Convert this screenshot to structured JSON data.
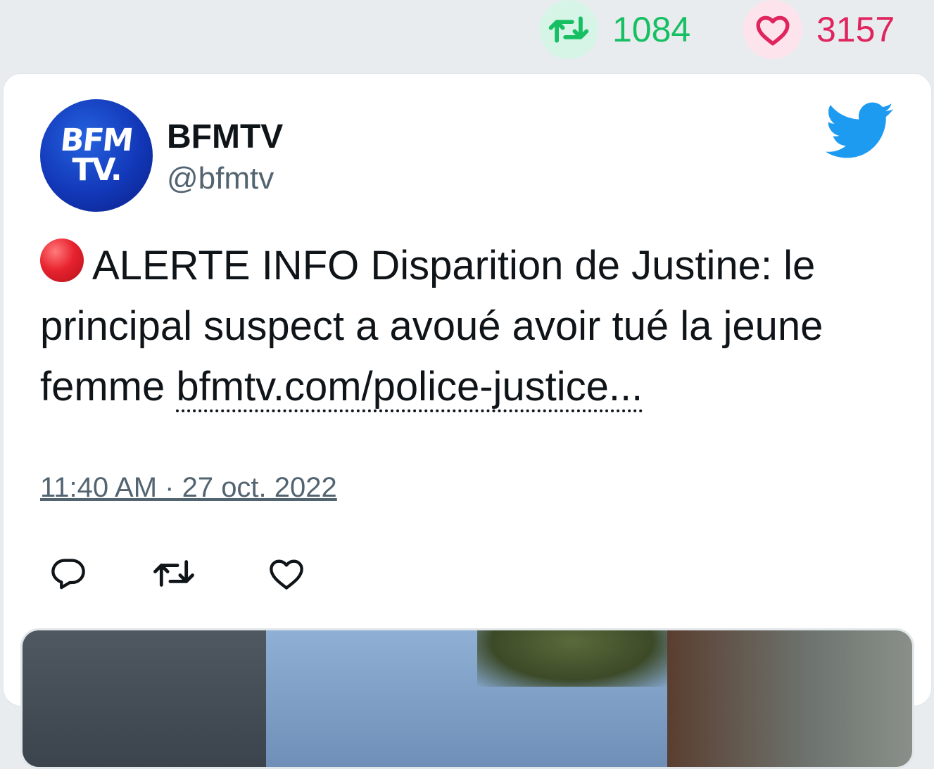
{
  "stats": {
    "retweet_count": "1084",
    "like_count": "3157"
  },
  "tweet": {
    "author_name": "BFMTV",
    "author_handle": "@bfmtv",
    "avatar_line1": "BFM",
    "avatar_line2": "TV.",
    "text_main": "ALERTE INFO Disparition de Justine: le principal suspect a avoué avoir tué la jeune femme ",
    "link_text": "bfmtv.com/police-justice...",
    "timestamp": "11:40 AM · 27 oct. 2022"
  },
  "colors": {
    "retweet": "#17bf63",
    "like": "#e0245e",
    "twitter_blue": "#1d9bf0",
    "secondary_text": "#536471"
  },
  "icons": {
    "retweet": "retweet-icon",
    "like": "heart-icon",
    "logo": "twitter-bird-icon",
    "reply": "reply-icon",
    "alert": "red-circle-icon"
  }
}
